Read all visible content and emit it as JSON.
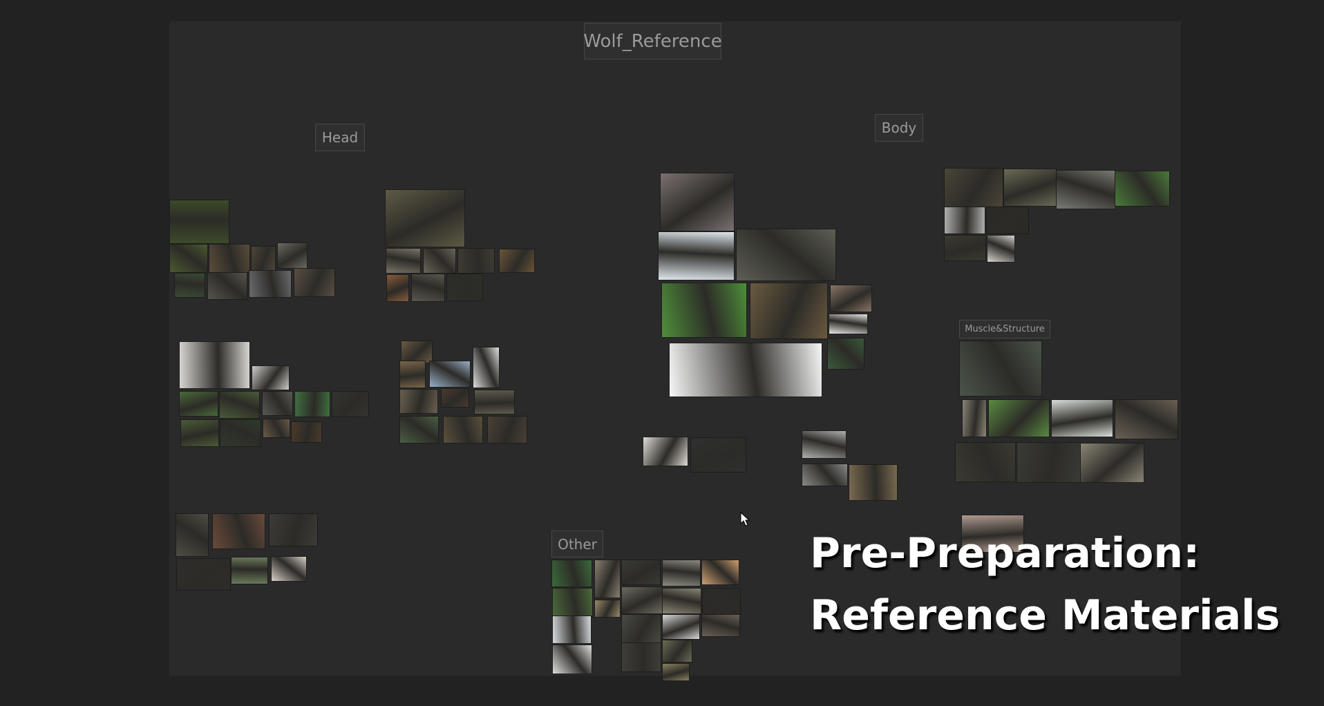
{
  "canvas": {
    "board_title": "Wolf_Reference"
  },
  "groups": {
    "head": "Head",
    "body": "Body",
    "muscle": "Muscle&Structure",
    "other": "Other"
  },
  "overlay": {
    "line1": "Pre-Preparation:",
    "line2": "Reference Materials"
  },
  "colors": {
    "background": "#222222",
    "board": "#2a2a2a",
    "label_text": "#9b9b9b",
    "overlay_text": "#ffffff"
  },
  "icons": {
    "cursor": "mouse-pointer-icon"
  }
}
